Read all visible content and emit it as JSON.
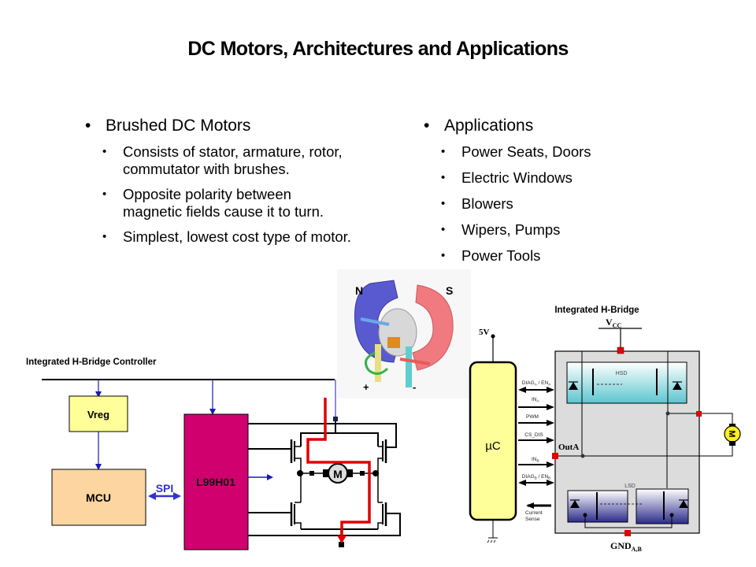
{
  "slide": {
    "title": "DC Motors, Architectures and Applications"
  },
  "left_column": {
    "heading": "Brushed DC Motors",
    "items": [
      {
        "line1": "Consists of stator, armature, rotor,",
        "line2": "commutator  with brushes."
      },
      {
        "line1": "Opposite polarity between",
        "line2": "magnetic  fields cause it to turn."
      },
      {
        "line1": "Simplest,  lowest cost type of motor.",
        "line2": ""
      }
    ]
  },
  "right_column": {
    "heading": "Applications",
    "items": [
      "Power Seats, Doors",
      "Electric Windows",
      "Blowers",
      "Wipers, Pumps",
      "Power Tools"
    ]
  },
  "motor_illustration": {
    "north_label": "N",
    "south_label": "S",
    "plus_label": "+",
    "minus_label": "-"
  },
  "controller_diagram": {
    "title": "Integrated H-Bridge Controller",
    "vreg_label": "Vreg",
    "mcu_label": "MCU",
    "spi_label": "SPI",
    "driver_label": "L99H01",
    "motor_label": "M",
    "colors": {
      "vreg": "#ffff99",
      "mcu": "#fcd5a0",
      "driver": "#d0006f",
      "current_path": "#e00000",
      "signal": "#1a1ab0"
    }
  },
  "hbridge_diagram": {
    "title": "Integrated H-Bridge",
    "vcc_label": "V",
    "vcc_sub": "CC",
    "supply_label": "5V",
    "uc_label": "µC",
    "signals": [
      {
        "main": "DIAG",
        "sub": "A",
        "sep": " / EN",
        "sub2": "A"
      },
      {
        "main": "IN",
        "sub": "A",
        "sep": "",
        "sub2": ""
      },
      {
        "main": "PWM",
        "sub": "",
        "sep": "",
        "sub2": ""
      },
      {
        "main": "CS_DIS",
        "sub": "",
        "sep": "",
        "sub2": ""
      },
      {
        "main": "IN",
        "sub": "B",
        "sep": "",
        "sub2": ""
      },
      {
        "main": "DIAG",
        "sub": "B",
        "sep": " / EN",
        "sub2": "B"
      }
    ],
    "current_sense_line1": "Current",
    "current_sense_line2": "Sense",
    "hsd_label": "HSD",
    "lsd_label": "LSD",
    "out_label": "OutA",
    "gnd_label": "GND",
    "gnd_sub": "A,B",
    "motor_label": "M"
  }
}
